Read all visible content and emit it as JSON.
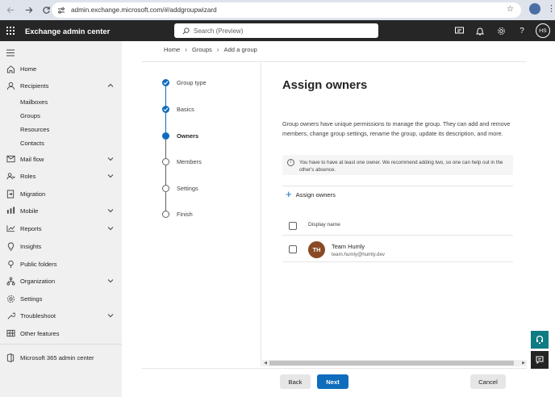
{
  "browser": {
    "url": "admin.exchange.microsoft.com/#/addgroupwizard"
  },
  "header": {
    "app_title": "Exchange admin center",
    "search_placeholder": "Search (Preview)",
    "avatar_initials": "HS"
  },
  "nav": {
    "items": [
      {
        "label": "Home",
        "icon": "home-icon"
      },
      {
        "label": "Recipients",
        "icon": "person-icon",
        "expanded": true
      },
      {
        "label": "Mail flow",
        "icon": "mail-flow-icon"
      },
      {
        "label": "Roles",
        "icon": "roles-icon"
      },
      {
        "label": "Migration",
        "icon": "migration-icon"
      },
      {
        "label": "Mobile",
        "icon": "mobile-icon"
      },
      {
        "label": "Reports",
        "icon": "reports-icon"
      },
      {
        "label": "Insights",
        "icon": "insights-icon"
      },
      {
        "label": "Public folders",
        "icon": "folder-icon"
      },
      {
        "label": "Organization",
        "icon": "organization-icon"
      },
      {
        "label": "Settings",
        "icon": "settings-icon"
      },
      {
        "label": "Troubleshoot",
        "icon": "troubleshoot-icon"
      },
      {
        "label": "Other features",
        "icon": "grid-icon"
      }
    ],
    "recipients_sub": [
      "Mailboxes",
      "Groups",
      "Resources",
      "Contacts"
    ],
    "m365_label": "Microsoft 365 admin center"
  },
  "breadcrumb": [
    "Home",
    "Groups",
    "Add a group"
  ],
  "wizard": {
    "steps": [
      "Group type",
      "Basics",
      "Owners",
      "Members",
      "Settings",
      "Finish"
    ],
    "current_step": 2
  },
  "page": {
    "title": "Assign owners",
    "description": "Group owners have unique permissions to manage the group. They can add and remove members, change group settings, rename the group, update its description, and more.",
    "info_message": "You have to have at least one owner. We recommend adding two, so one can help out in the other's absence.",
    "assign_label": "Assign owners",
    "column_header": "Display name",
    "owners": [
      {
        "initials": "TH",
        "name": "Team Humly",
        "email": "team.humly@humly.dev",
        "avatar_color": "#8a4a25"
      }
    ]
  },
  "footer": {
    "back_label": "Back",
    "next_label": "Next",
    "cancel_label": "Cancel"
  },
  "colors": {
    "accent": "#0f6cbd",
    "header_bg": "#262626",
    "nav_bg": "#f0f0f0",
    "teal": "#0f7b83"
  }
}
